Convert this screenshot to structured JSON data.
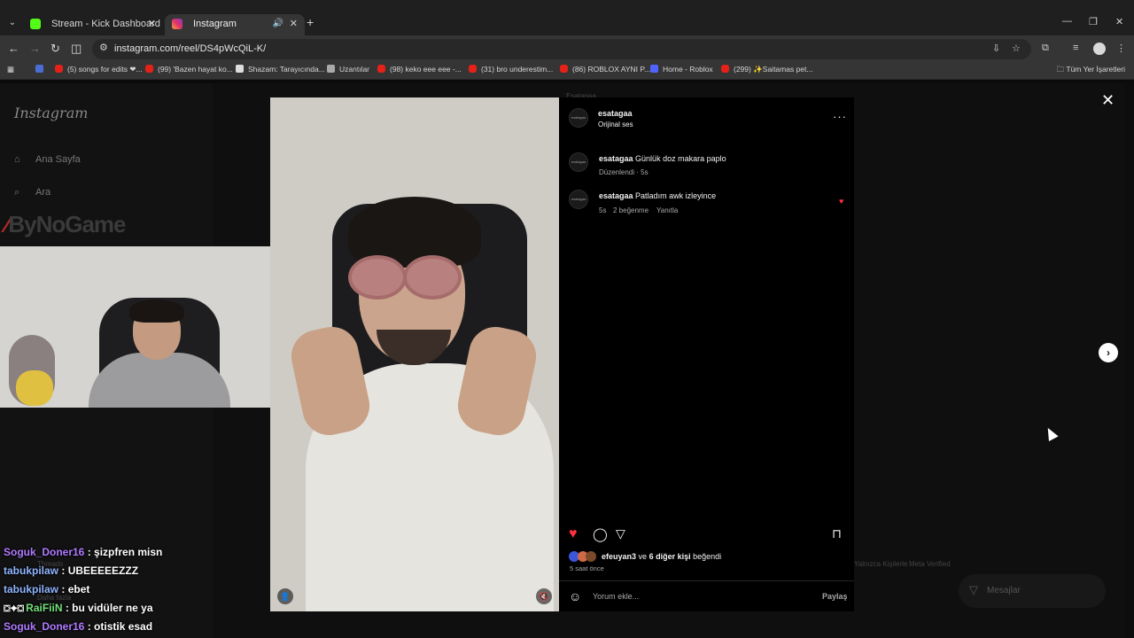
{
  "browser": {
    "tabs": [
      {
        "title": "Stream - Kick Dashboard",
        "favicon_color": "#53fc18"
      },
      {
        "title": "Instagram",
        "favicon_color": "#e1306c",
        "active": true
      }
    ],
    "url": "instagram.com/reel/DS4pWcQiL-K/",
    "bookmarks": [
      {
        "label": "(5) songs for edits ❤...",
        "icon": "youtube-icon"
      },
      {
        "label": "(99) 'Bazen hayat ko...",
        "icon": "youtube-icon"
      },
      {
        "label": "Shazam: Tarayıcında...",
        "icon": "shazam-icon"
      },
      {
        "label": "Uzantılar",
        "icon": "puzzle-icon"
      },
      {
        "label": "(98) keko eee eee -...",
        "icon": "youtube-icon"
      },
      {
        "label": "(31) bro underestim...",
        "icon": "youtube-icon"
      },
      {
        "label": "(86) ROBLOX AYNI P...",
        "icon": "youtube-icon"
      },
      {
        "label": "Home - Roblox",
        "icon": "roblox-icon"
      },
      {
        "label": "(299) ✨Saitamas pet...",
        "icon": "youtube-icon"
      }
    ],
    "bookmarks_all": "Tüm Yer İşaretleri"
  },
  "instagram": {
    "logo": "Instagram",
    "nav": [
      {
        "label": "Ana Sayfa",
        "icon": "home-icon"
      },
      {
        "label": "Ara",
        "icon": "search-icon"
      }
    ],
    "background_texts": {
      "threads": "Threads",
      "more": "Daha fazla",
      "footer_1": "Yalnızca Kişilerle",
      "footer_2": "Meta Verified",
      "header_user": "Esatagaa"
    },
    "post": {
      "author": "esatagaa",
      "audio": "Orijinal ses",
      "caption_user": "esatagaa",
      "caption": "Günlük doz makara paplo",
      "caption_meta": "Düzenlendi · 5s",
      "comment_user": "esatagaa",
      "comment": "Patladım awk izleyince",
      "comment_time": "5s",
      "comment_likes": "2 beğenme",
      "comment_reply": "Yanıtla",
      "liked_by_user": "efeuyan3",
      "liked_by_rest_connector": "ve",
      "liked_by_others": "6 diğer kişi",
      "liked_by_suffix": "beğendi",
      "time_ago": "5 saat önce",
      "comment_placeholder": "Yorum ekle...",
      "share_label": "Paylaş"
    },
    "messages_label": "Mesajlar"
  },
  "overlay": {
    "brand": "ByNoGame",
    "chat": [
      {
        "user": "Soguk_Doner16",
        "message": ": şizpfren misn",
        "color": "#b07bff"
      },
      {
        "user": "tabukpilaw",
        "message": ": UBEEEEEZZZ",
        "color": "#8fb4ff"
      },
      {
        "user": "tabukpilaw",
        "message": ": ebet",
        "color": "#8fb4ff"
      },
      {
        "user": "RaiFiiN",
        "message": ": bu vidüler ne ya",
        "color": "#74e07a"
      },
      {
        "user": "Soguk_Doner16",
        "message": ": otistik esad",
        "color": "#b07bff"
      }
    ]
  }
}
